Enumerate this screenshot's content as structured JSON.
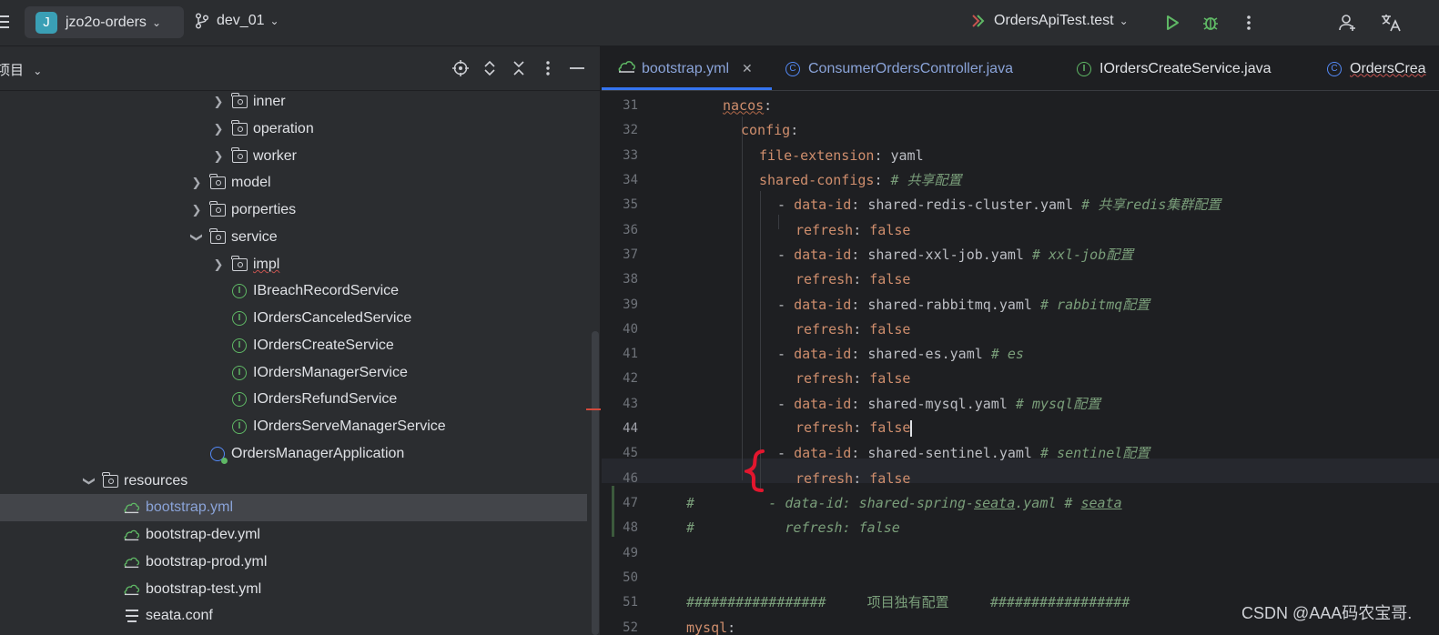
{
  "toolbar": {
    "project_initial": "J",
    "project_name": "jzo2o-orders",
    "branch": "dev_01",
    "run_config": "OrdersApiTest.test"
  },
  "project_panel": {
    "title": "项目",
    "tree": [
      {
        "label": "inner",
        "kind": "folder",
        "expanded": false
      },
      {
        "label": "operation",
        "kind": "folder",
        "expanded": false
      },
      {
        "label": "worker",
        "kind": "folder",
        "expanded": false
      },
      {
        "label": "model",
        "kind": "folder",
        "expanded": false
      },
      {
        "label": "porperties",
        "kind": "folder",
        "expanded": false
      },
      {
        "label": "service",
        "kind": "folder",
        "expanded": true
      },
      {
        "label": "impl",
        "kind": "folder",
        "expanded": false
      },
      {
        "label": "IBreachRecordService",
        "kind": "interface"
      },
      {
        "label": "IOrdersCanceledService",
        "kind": "interface"
      },
      {
        "label": "IOrdersCreateService",
        "kind": "interface"
      },
      {
        "label": "IOrdersManagerService",
        "kind": "interface"
      },
      {
        "label": "IOrdersRefundService",
        "kind": "interface"
      },
      {
        "label": "IOrdersServeManagerService",
        "kind": "interface"
      },
      {
        "label": "OrdersManagerApplication",
        "kind": "application"
      },
      {
        "label": "resources",
        "kind": "resource-folder",
        "expanded": true
      },
      {
        "label": "bootstrap.yml",
        "kind": "yaml",
        "selected": true
      },
      {
        "label": "bootstrap-dev.yml",
        "kind": "yaml"
      },
      {
        "label": "bootstrap-prod.yml",
        "kind": "yaml"
      },
      {
        "label": "bootstrap-test.yml",
        "kind": "yaml"
      },
      {
        "label": "seata.conf",
        "kind": "text"
      }
    ]
  },
  "editor": {
    "tabs": [
      {
        "label": "bootstrap.yml",
        "kind": "yaml",
        "active": true
      },
      {
        "label": "ConsumerOrdersController.java",
        "kind": "class"
      },
      {
        "label": "IOrdersCreateService.java",
        "kind": "interface"
      },
      {
        "label": "OrdersCrea",
        "kind": "class"
      }
    ],
    "line_numbers": [
      "31",
      "32",
      "33",
      "34",
      "35",
      "36",
      "37",
      "38",
      "39",
      "40",
      "41",
      "42",
      "43",
      "44",
      "45",
      "46",
      "47",
      "48",
      "49",
      "50",
      "51",
      "52"
    ],
    "code": {
      "l31_key": "nacos",
      "l32_key": "config",
      "l33_key": "file-extension",
      "l33_val": "yaml",
      "l34_key": "shared-configs",
      "l34_comment": "# 共享配置",
      "l35_val": "shared-redis-cluster.yaml",
      "l35_comment": "# 共享redis集群配置",
      "l37_val": "shared-xxl-job.yaml",
      "l37_comment": "# xxl-job配置",
      "l39_val": "shared-rabbitmq.yaml",
      "l39_comment": "# rabbitmq配置",
      "l41_val": "shared-es.yaml",
      "l41_comment": "# es",
      "l43_val": "shared-mysql.yaml",
      "l43_comment": "# mysql配置",
      "l45_val": "shared-sentinel.yaml",
      "l45_comment": "# sentinel配置",
      "dash": "- ",
      "data_id_key": "data-id",
      "refresh_key": "refresh",
      "false_val": "false",
      "l47_a": "#         - data-id: shared-spring-",
      "l47_b": "seata",
      "l47_c": ".yaml # ",
      "l47_d": "seata",
      "l48": "#           refresh: false",
      "l51": "#################     项目独有配置     #################",
      "l52_key": "mysql"
    }
  },
  "watermark": "CSDN @AAA码农宝哥.",
  "colors": {
    "accent": "#3574f0",
    "yaml_key": "#cf8e6d",
    "comment": "#7a9e7a",
    "interface_icon": "#5fb865",
    "class_icon": "#548af7",
    "annotation_red": "#e3162e"
  }
}
